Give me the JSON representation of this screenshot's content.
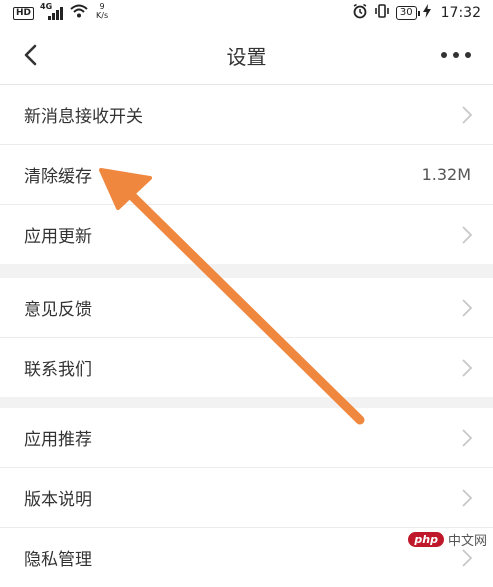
{
  "status_bar": {
    "hd": "HD",
    "network": "4G",
    "speed_value": "9",
    "speed_unit": "K/s",
    "battery": "30",
    "time": "17:32"
  },
  "nav": {
    "title": "设置"
  },
  "sections": [
    {
      "items": [
        {
          "label": "新消息接收开关",
          "value": "",
          "chevron": true
        },
        {
          "label": "清除缓存",
          "value": "1.32M",
          "chevron": false
        },
        {
          "label": "应用更新",
          "value": "",
          "chevron": true
        }
      ]
    },
    {
      "items": [
        {
          "label": "意见反馈",
          "value": "",
          "chevron": true
        },
        {
          "label": "联系我们",
          "value": "",
          "chevron": true
        }
      ]
    },
    {
      "items": [
        {
          "label": "应用推荐",
          "value": "",
          "chevron": true
        },
        {
          "label": "版本说明",
          "value": "",
          "chevron": true
        },
        {
          "label": "隐私管理",
          "value": "",
          "chevron": true
        }
      ]
    }
  ],
  "watermark": {
    "logo": "php",
    "text": "中文网"
  },
  "colors": {
    "annotation_arrow": "#f0873f",
    "background": "#f2f2f2",
    "row_background": "#ffffff"
  }
}
